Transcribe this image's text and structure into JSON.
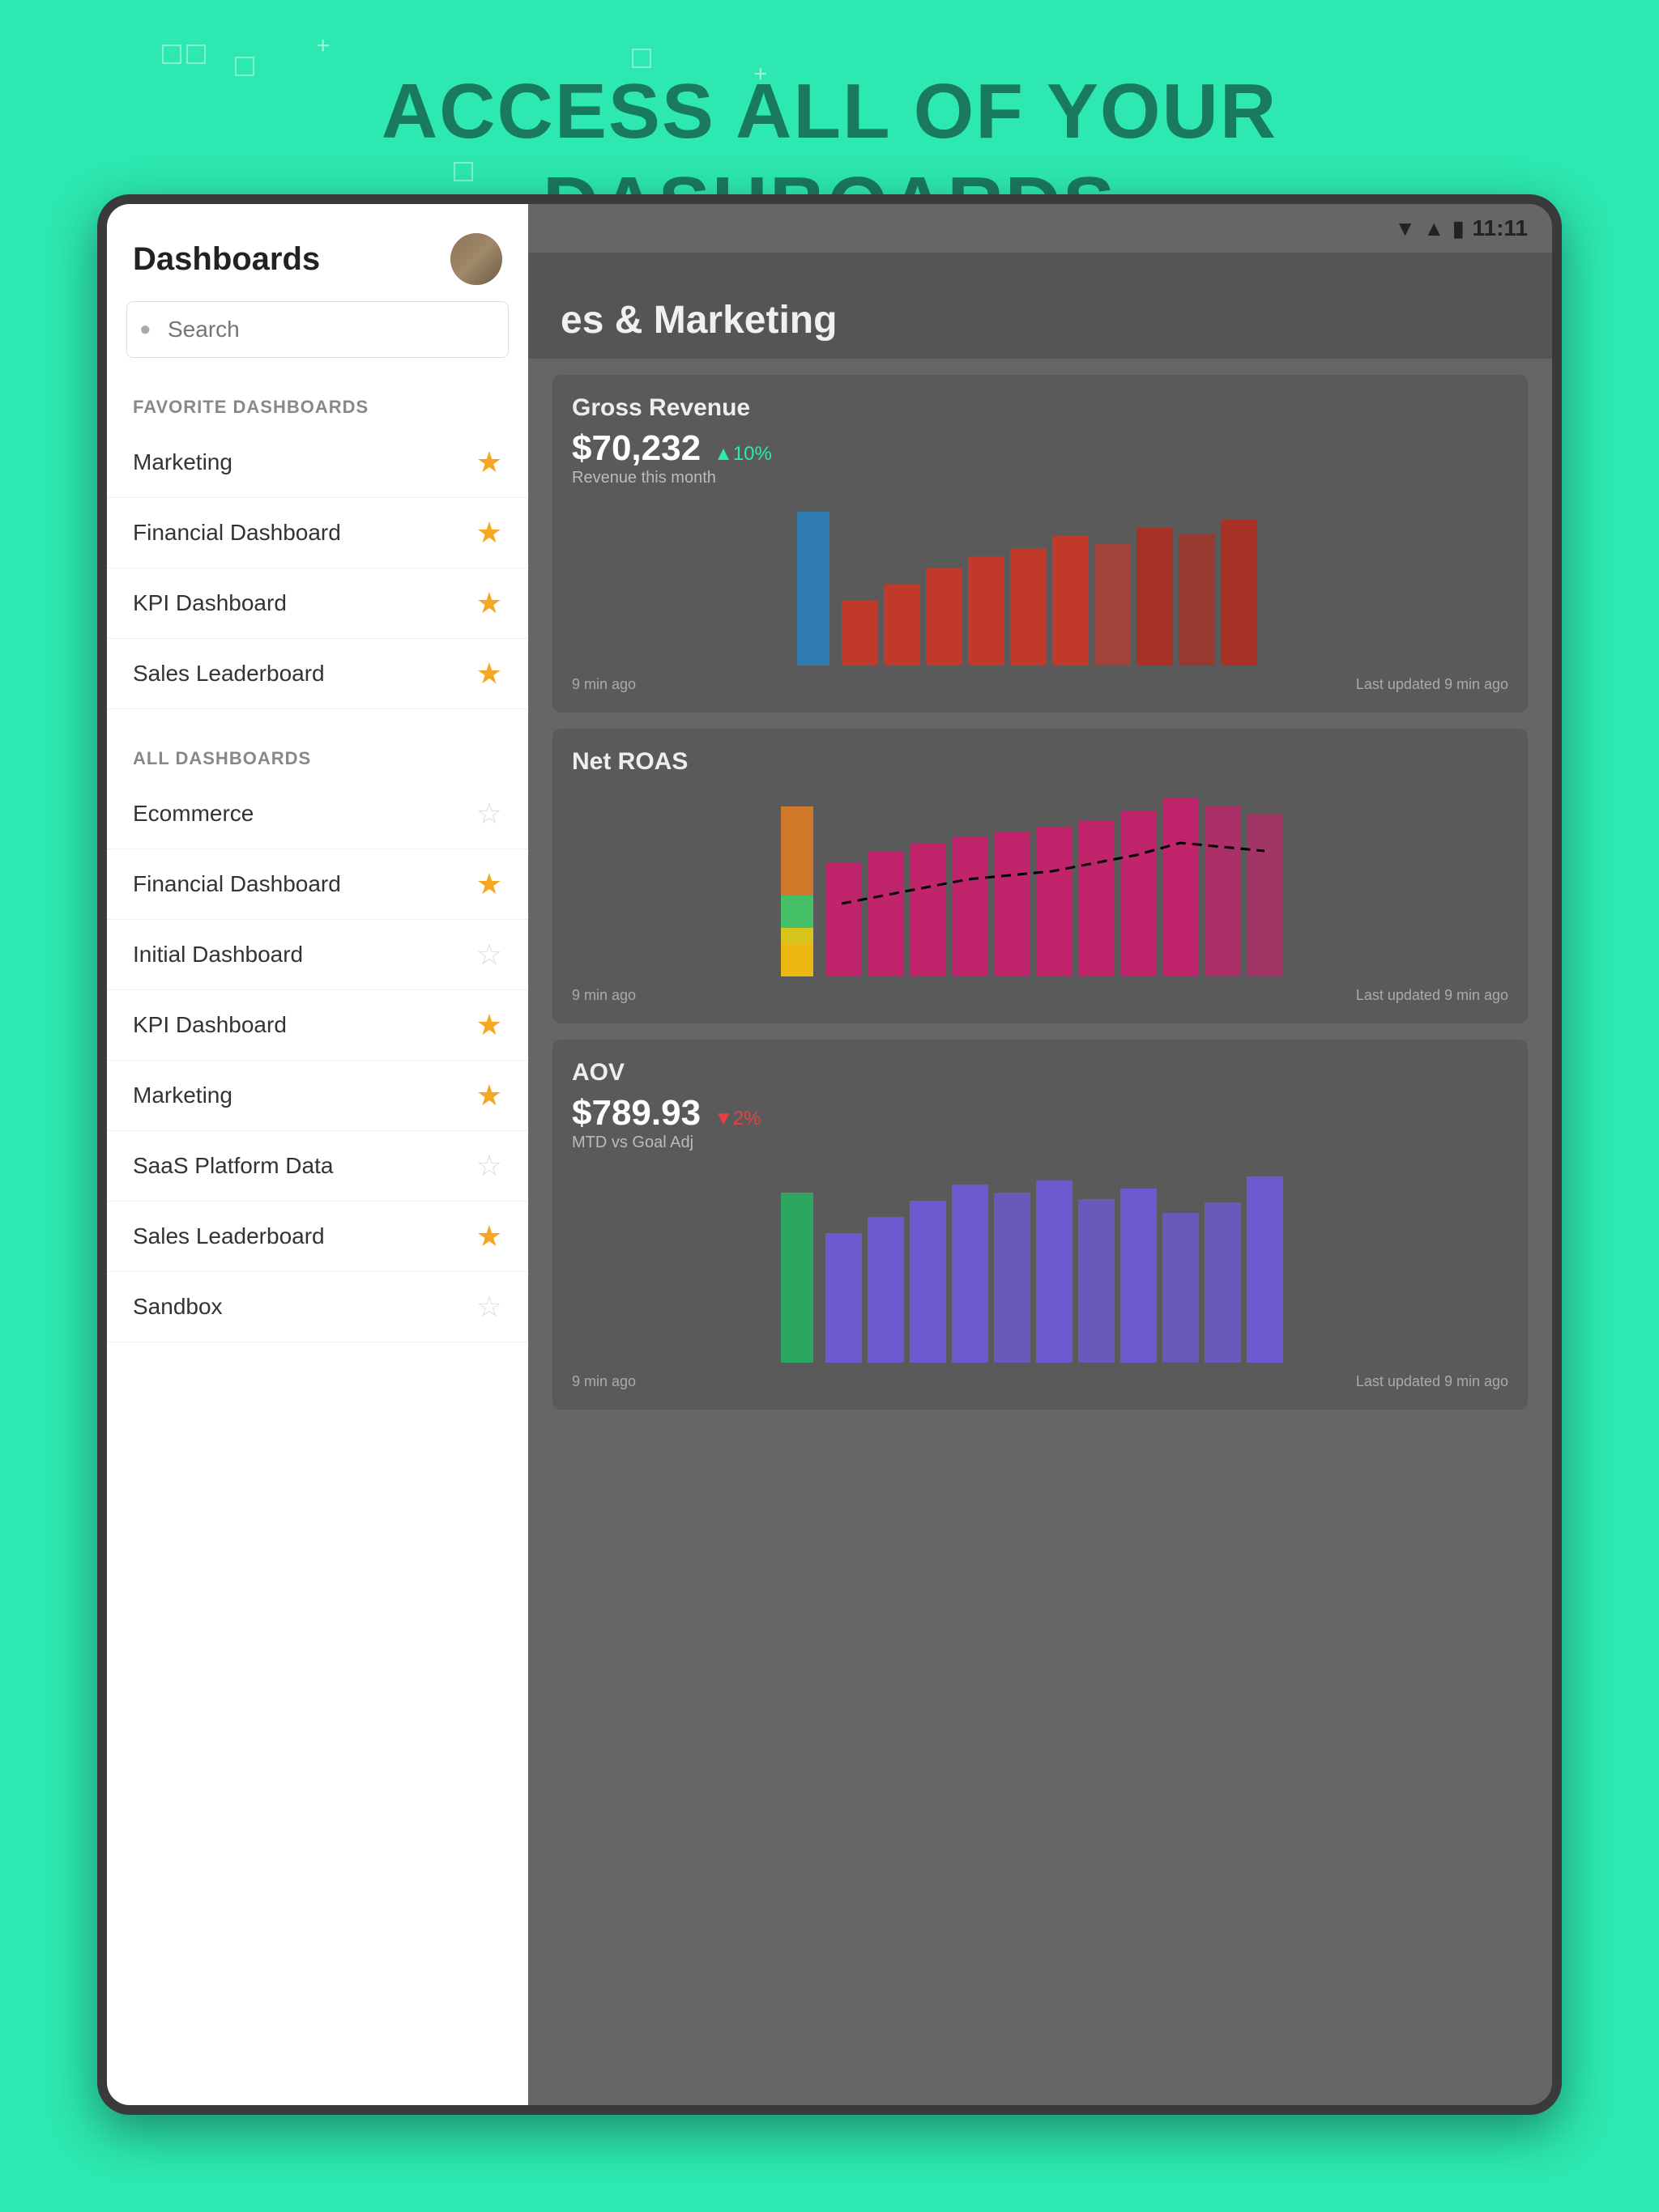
{
  "background": {
    "color": "#2de8b0"
  },
  "heading": {
    "line1": "ACCESS ALL OF YOUR",
    "line2": "DASHBOARDS"
  },
  "status_bar": {
    "time": "11:11"
  },
  "sidebar": {
    "title": "Dashboards",
    "search_placeholder": "Search",
    "search_label": "Search",
    "favorite_section_title": "FAVORITE DASHBOARDS",
    "all_section_title": "ALL DASHBOARDS",
    "favorite_items": [
      {
        "label": "Marketing",
        "starred": true
      },
      {
        "label": "Financial Dashboard",
        "starred": true
      },
      {
        "label": "KPI Dashboard",
        "starred": true
      },
      {
        "label": "Sales Leaderboard",
        "starred": true
      }
    ],
    "all_items": [
      {
        "label": "Ecommerce",
        "starred": false
      },
      {
        "label": "Financial Dashboard",
        "starred": true
      },
      {
        "label": "Initial Dashboard",
        "starred": false
      },
      {
        "label": "KPI Dashboard",
        "starred": true
      },
      {
        "label": "Marketing",
        "starred": true
      },
      {
        "label": "SaaS Platform Data",
        "starred": false
      },
      {
        "label": "Sales Leaderboard",
        "starred": true
      },
      {
        "label": "Sandbox",
        "starred": false
      }
    ]
  },
  "main": {
    "page_title": "es & Marketing",
    "charts": [
      {
        "id": "gross-revenue",
        "title": "Gross Revenue",
        "value": "$70,232",
        "change": "▲10%",
        "change_type": "positive",
        "subtitle": "Revenue this month",
        "updated_left": "9 min ago",
        "updated_right": "Last updated 9 min ago",
        "bar_color": "#c0392b",
        "bar_heights": [
          40,
          55,
          65,
          80,
          100,
          130,
          145,
          160,
          140,
          175
        ]
      },
      {
        "id": "net-roas",
        "title": "Net ROAS",
        "value": "",
        "change": "",
        "change_type": "",
        "subtitle": "",
        "updated_left": "9 min ago",
        "updated_right": "Last updated 9 min ago",
        "bar_color": "#c0256b",
        "bar_heights": [
          80,
          90,
          100,
          110,
          115,
          120,
          125,
          135,
          160,
          145
        ]
      },
      {
        "id": "aov",
        "title": "AOV",
        "value": "$789.93",
        "change": "▼2%",
        "change_type": "negative",
        "subtitle": "MTD vs Goal Adj",
        "updated_left": "9 min ago",
        "updated_right": "Last updated 9 min ago",
        "bar_color": "#6a5acd",
        "bar_heights": [
          90,
          110,
          130,
          150,
          145,
          155,
          140,
          150,
          120,
          160
        ]
      }
    ]
  }
}
